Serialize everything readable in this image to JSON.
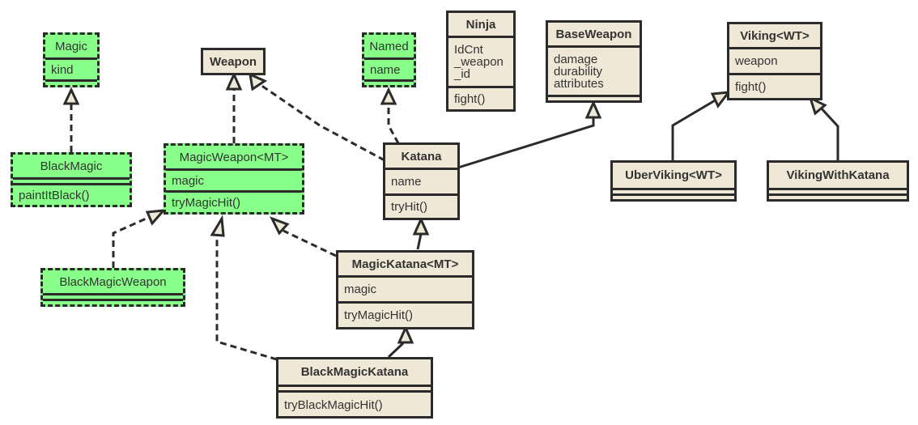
{
  "diagram": {
    "type": "UML class diagram",
    "colors": {
      "class_fill": "#efe8d7",
      "interface_fill": "#88ff88",
      "stroke": "#2b2b2b",
      "text": "#333333"
    },
    "classes": {
      "magic": {
        "name": "Magic",
        "fields": [
          "kind"
        ],
        "methods": [],
        "style": "interface"
      },
      "black_magic": {
        "name": "BlackMagic",
        "fields": [],
        "methods": [
          "paintItBlack()"
        ],
        "style": "interface"
      },
      "weapon": {
        "name": "Weapon",
        "fields": null,
        "methods": null,
        "style": "class"
      },
      "magic_weapon": {
        "name": "MagicWeapon<MT>",
        "fields": [
          "magic"
        ],
        "methods": [
          "tryMagicHit()"
        ],
        "style": "interface"
      },
      "black_magic_weapon": {
        "name": "BlackMagicWeapon",
        "fields": [],
        "methods": [],
        "style": "interface"
      },
      "named": {
        "name": "Named",
        "fields": [
          "name"
        ],
        "methods": [],
        "style": "interface"
      },
      "ninja": {
        "name": "Ninja",
        "fields": [
          "IdCnt",
          "_weapon",
          "_id"
        ],
        "methods": [
          "fight()"
        ],
        "style": "class"
      },
      "base_weapon": {
        "name": "BaseWeapon",
        "fields": [
          "damage",
          "durability",
          "attributes"
        ],
        "methods": [],
        "style": "class"
      },
      "katana": {
        "name": "Katana",
        "fields": [
          "name"
        ],
        "methods": [
          "tryHit()"
        ],
        "style": "class"
      },
      "magic_katana": {
        "name": "MagicKatana<MT>",
        "fields": [
          "magic"
        ],
        "methods": [
          "tryMagicHit()"
        ],
        "style": "class"
      },
      "black_magic_katana": {
        "name": "BlackMagicKatana",
        "fields": [],
        "methods": [
          "tryBlackMagicHit()"
        ],
        "style": "class"
      },
      "viking": {
        "name": "Viking<WT>",
        "fields": [
          "weapon"
        ],
        "methods": [
          "fight()"
        ],
        "style": "class"
      },
      "uber_viking": {
        "name": "UberViking<WT>",
        "fields": [],
        "methods": [],
        "style": "class"
      },
      "viking_with_katana": {
        "name": "VikingWithKatana",
        "fields": [],
        "methods": [],
        "style": "class"
      }
    },
    "relations": [
      {
        "from": "BlackMagic",
        "to": "Magic",
        "kind": "realization"
      },
      {
        "from": "MagicWeapon<MT>",
        "to": "Weapon",
        "kind": "realization"
      },
      {
        "from": "Katana",
        "to": "Weapon",
        "kind": "realization"
      },
      {
        "from": "Katana",
        "to": "Named",
        "kind": "realization"
      },
      {
        "from": "Katana",
        "to": "BaseWeapon",
        "kind": "generalization"
      },
      {
        "from": "BlackMagicWeapon",
        "to": "MagicWeapon<MT>",
        "kind": "realization"
      },
      {
        "from": "MagicKatana<MT>",
        "to": "MagicWeapon<MT>",
        "kind": "realization"
      },
      {
        "from": "BlackMagicKatana",
        "to": "MagicWeapon<MT>",
        "kind": "realization"
      },
      {
        "from": "MagicKatana<MT>",
        "to": "Katana",
        "kind": "generalization"
      },
      {
        "from": "BlackMagicKatana",
        "to": "MagicKatana<MT>",
        "kind": "generalization"
      },
      {
        "from": "UberViking<WT>",
        "to": "Viking<WT>",
        "kind": "generalization"
      },
      {
        "from": "VikingWithKatana",
        "to": "Viking<WT>",
        "kind": "generalization"
      }
    ]
  }
}
